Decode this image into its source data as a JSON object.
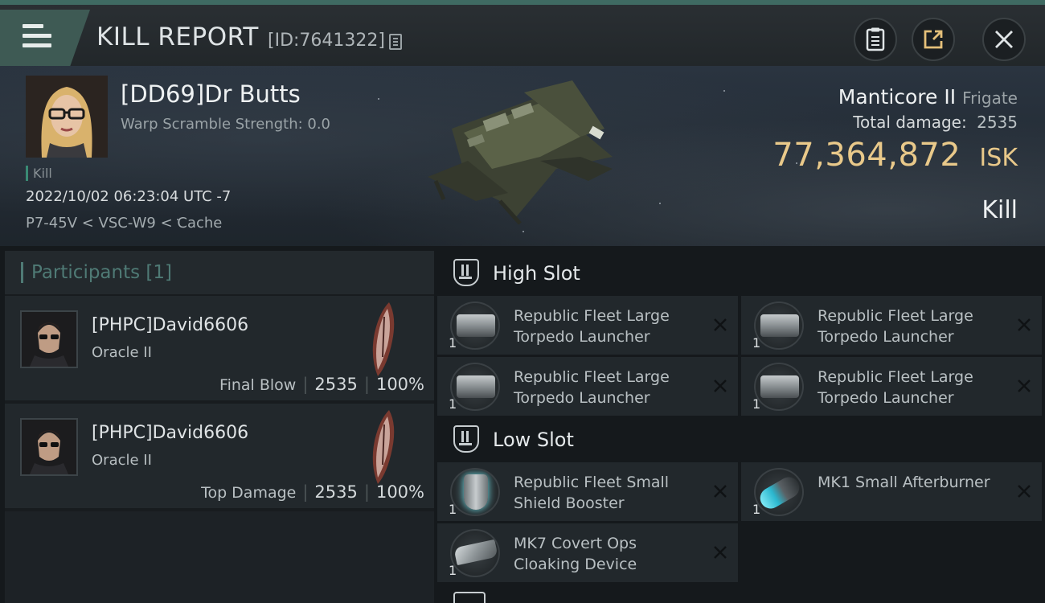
{
  "header": {
    "title": "KILL REPORT",
    "report_id": "[ID:7641322]"
  },
  "victim": {
    "name": "[DD69]Dr Butts",
    "warp_scramble": "Warp Scramble Strength: 0.0",
    "tag": "Kill",
    "datetime": "2022/10/02 06:23:04 UTC -7",
    "location": "P7-45V < VSC-W9 < Cache",
    "ship_name": "Manticore II",
    "ship_class": "Frigate",
    "total_damage_label": "Total damage:",
    "total_damage": "2535",
    "isk_value": "77,364,872",
    "isk_unit": "ISK",
    "result": "Kill"
  },
  "participants": {
    "title": "Participants",
    "count": "[1]",
    "list": [
      {
        "name": "[PHPC]David6606",
        "ship": "Oracle II",
        "role": "Final Blow",
        "damage": "2535",
        "percent": "100%"
      },
      {
        "name": "[PHPC]David6606",
        "ship": "Oracle II",
        "role": "Top Damage",
        "damage": "2535",
        "percent": "100%"
      }
    ]
  },
  "slots": {
    "high": {
      "title": "High Slot",
      "modules": [
        {
          "name": "Republic Fleet Large Torpedo Launcher",
          "qty": "1"
        },
        {
          "name": "Republic Fleet Large Torpedo Launcher",
          "qty": "1"
        },
        {
          "name": "Republic Fleet Large Torpedo Launcher",
          "qty": "1"
        },
        {
          "name": "Republic Fleet Large Torpedo Launcher",
          "qty": "1"
        }
      ]
    },
    "low": {
      "title": "Low Slot",
      "modules": [
        {
          "name": "Republic Fleet Small Shield Booster",
          "qty": "1"
        },
        {
          "name": "MK1 Small Afterburner",
          "qty": "1"
        },
        {
          "name": "MK7 Covert Ops Cloaking Device",
          "qty": "1"
        }
      ]
    }
  },
  "colors": {
    "accent": "#3f6a62",
    "isk": "#e9c98a",
    "participants_title": "#4f7a75"
  }
}
